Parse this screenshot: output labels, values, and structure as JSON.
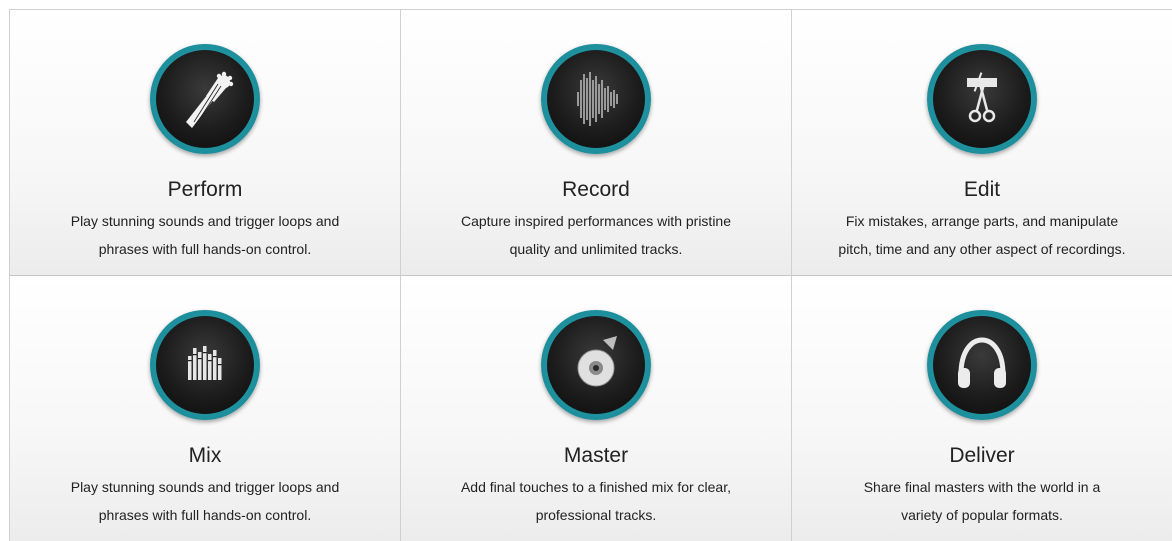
{
  "features": [
    {
      "title": "Perform",
      "icon": "guitar-headstock-icon",
      "desc": [
        "Play stunning sounds and trigger loops and",
        "phrases with full hands-on control."
      ]
    },
    {
      "title": "Record",
      "icon": "waveform-icon",
      "desc": [
        "Capture inspired performances with pristine",
        "quality and unlimited tracks."
      ]
    },
    {
      "title": "Edit",
      "icon": "scissors-icon",
      "desc": [
        "Fix mistakes, arrange parts, and manipulate",
        "pitch, time and any other aspect of recordings."
      ]
    },
    {
      "title": "Mix",
      "icon": "equalizer-bars-icon",
      "desc": [
        "Play stunning sounds and trigger loops and",
        "phrases with full hands-on control."
      ]
    },
    {
      "title": "Master",
      "icon": "disc-icon",
      "desc": [
        "Add final touches to a finished mix for clear,",
        "professional tracks."
      ]
    },
    {
      "title": "Deliver",
      "icon": "headphones-icon",
      "desc": [
        "Share final masters with the world in a",
        "variety of popular formats."
      ]
    }
  ]
}
